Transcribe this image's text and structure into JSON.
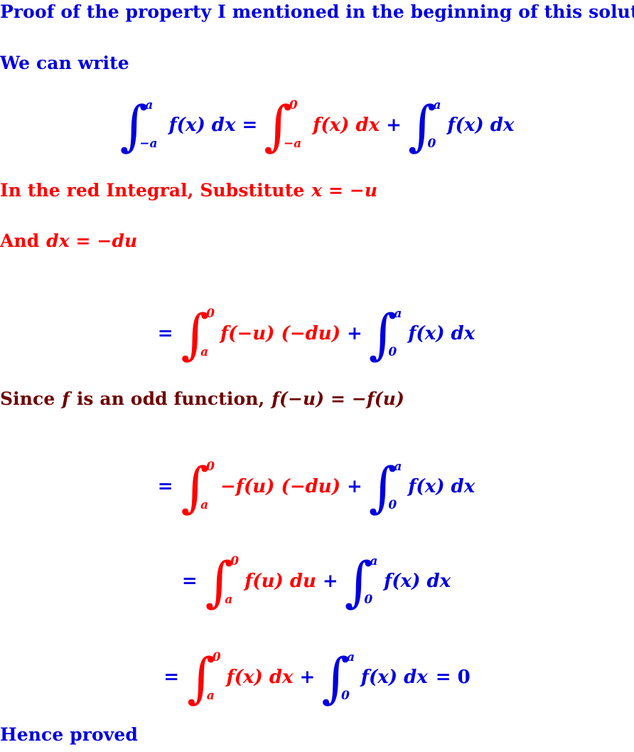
{
  "document": {
    "background": "#ffffff",
    "colors": {
      "blue": "#0000E0",
      "red": "#FF0000",
      "maroon": "#6E0000"
    },
    "title_line": "Proof of the property I mentioned in the beginning of this solution.",
    "intro_line": "We can write",
    "substitute_line_prefix": "In the red Integral, Substitute ",
    "substitute_line_math": "x = −u",
    "and_line_prefix": "And ",
    "and_line_math": "dx = −du",
    "odd_line_prefix": "Since ",
    "odd_line_f": "f",
    "odd_line_middle": " is an odd function, ",
    "odd_line_math": "f(−u) = −f(u)",
    "conclusion_line": "Hence proved"
  },
  "equations": [
    {
      "id": "eq1",
      "lead": "",
      "terms": [
        {
          "color": "blue",
          "upper": "a",
          "lower": "−a",
          "integrand": "f(x)",
          "differential": "dx"
        },
        {
          "color": "red",
          "upper": "0",
          "lower": "−a",
          "integrand": "f(x)",
          "differential": "dx"
        },
        {
          "color": "blue",
          "upper": "a",
          "lower": "0",
          "integrand": "f(x)",
          "differential": "dx"
        }
      ],
      "operators": {
        "between_1_2": "=",
        "between_2_3": "+"
      },
      "tail": ""
    },
    {
      "id": "eq2",
      "lead": "=",
      "terms": [
        {
          "color": "red",
          "upper": "0",
          "lower": "a",
          "integrand": "f(−u) (−du)",
          "differential": ""
        },
        {
          "color": "blue",
          "upper": "a",
          "lower": "0",
          "integrand": "f(x)",
          "differential": "dx"
        }
      ],
      "operators": {
        "between_1_2": "+"
      },
      "tail": ""
    },
    {
      "id": "eq3",
      "lead": "=",
      "terms": [
        {
          "color": "red",
          "upper": "0",
          "lower": "a",
          "integrand": "−f(u) (−du)",
          "differential": ""
        },
        {
          "color": "blue",
          "upper": "a",
          "lower": "0",
          "integrand": "f(x)",
          "differential": "dx"
        }
      ],
      "operators": {
        "between_1_2": "+"
      },
      "tail": ""
    },
    {
      "id": "eq4",
      "lead": "=",
      "terms": [
        {
          "color": "red",
          "upper": "0",
          "lower": "a",
          "integrand": "f(u)",
          "differential": "du"
        },
        {
          "color": "blue",
          "upper": "a",
          "lower": "0",
          "integrand": "f(x)",
          "differential": "dx"
        }
      ],
      "operators": {
        "between_1_2": "+"
      },
      "tail": ""
    },
    {
      "id": "eq5",
      "lead": "=",
      "terms": [
        {
          "color": "red",
          "upper": "0",
          "lower": "a",
          "integrand": "f(x)",
          "differential": "dx"
        },
        {
          "color": "blue",
          "upper": "a",
          "lower": "0",
          "integrand": "f(x)",
          "differential": "dx"
        }
      ],
      "operators": {
        "between_1_2": "+"
      },
      "tail": "= 0"
    }
  ],
  "symbols": {
    "integral_glyph": "∫"
  }
}
